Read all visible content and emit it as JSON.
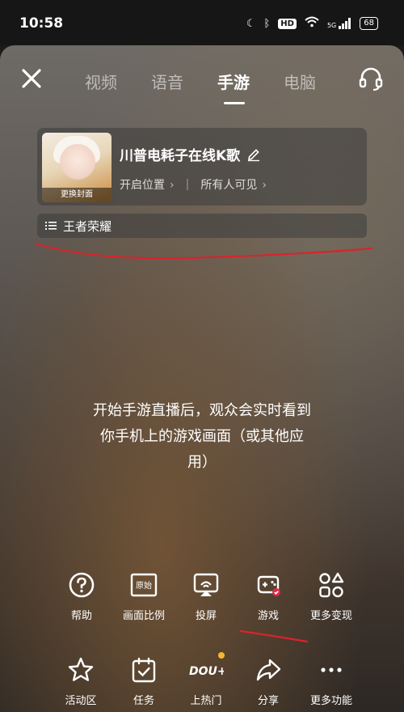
{
  "status_bar": {
    "time": "10:58",
    "hd": "HD",
    "network": "5G",
    "battery": "68"
  },
  "tabs": [
    {
      "label": "视频"
    },
    {
      "label": "语音"
    },
    {
      "label": "手游",
      "active": true
    },
    {
      "label": "电脑"
    }
  ],
  "room": {
    "cover_label": "更换封面",
    "title": "川普电耗子在线K歌",
    "location": "开启位置",
    "visibility": "所有人可见"
  },
  "game": {
    "name": "王者荣耀"
  },
  "hint": {
    "line1": "开始手游直播后，观众会实时看到",
    "line2": "你手机上的游戏画面（或其他应",
    "line3": "用）"
  },
  "tools": [
    {
      "label": "帮助",
      "icon": "help-icon"
    },
    {
      "label": "画面比例",
      "icon": "aspect-ratio-icon",
      "badge": "原始"
    },
    {
      "label": "投屏",
      "icon": "cast-icon"
    },
    {
      "label": "游戏",
      "icon": "gamepad-icon"
    },
    {
      "label": "更多变现",
      "icon": "grid-shapes-icon"
    }
  ],
  "bottom_bar": [
    {
      "label": "活动区",
      "icon": "star-icon"
    },
    {
      "label": "任务",
      "icon": "task-icon"
    },
    {
      "label": "上热门",
      "icon": "dou-plus-icon",
      "text": "DOU+"
    },
    {
      "label": "分享",
      "icon": "share-icon"
    },
    {
      "label": "更多功能",
      "icon": "more-icon"
    }
  ],
  "colors": {
    "annotation_red": "#d9232d",
    "notification_dot": "#f5b82e"
  }
}
